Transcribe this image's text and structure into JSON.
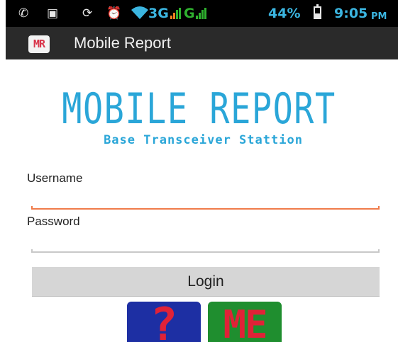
{
  "status_bar": {
    "icons": [
      "whatsapp-icon",
      "message-icon",
      "sync-icon",
      "alarm-icon",
      "wifi-icon",
      "signal-icon",
      "battery-icon"
    ],
    "network_1": "3G",
    "network_2": "G",
    "battery_percent": "44%",
    "battery_level": 0.44,
    "time": "9:05",
    "ampm": "PM"
  },
  "action_bar": {
    "icon_text": "MR",
    "title": "Mobile Report"
  },
  "logo": {
    "title": "MOBILE REPORT",
    "subtitle": "Base Transceiver Stattion"
  },
  "form": {
    "username_label": "Username",
    "username_value": "",
    "password_label": "Password",
    "password_value": "",
    "login_label": "Login"
  },
  "tiles": {
    "help_text": "?",
    "me_text": "ME"
  },
  "colors": {
    "accent": "#2aa6d8",
    "focus_underline": "#f07b4a",
    "idle_underline": "#c8c8c8",
    "status_text": "#3bb5e0",
    "signal_green": "#2fb12f"
  }
}
